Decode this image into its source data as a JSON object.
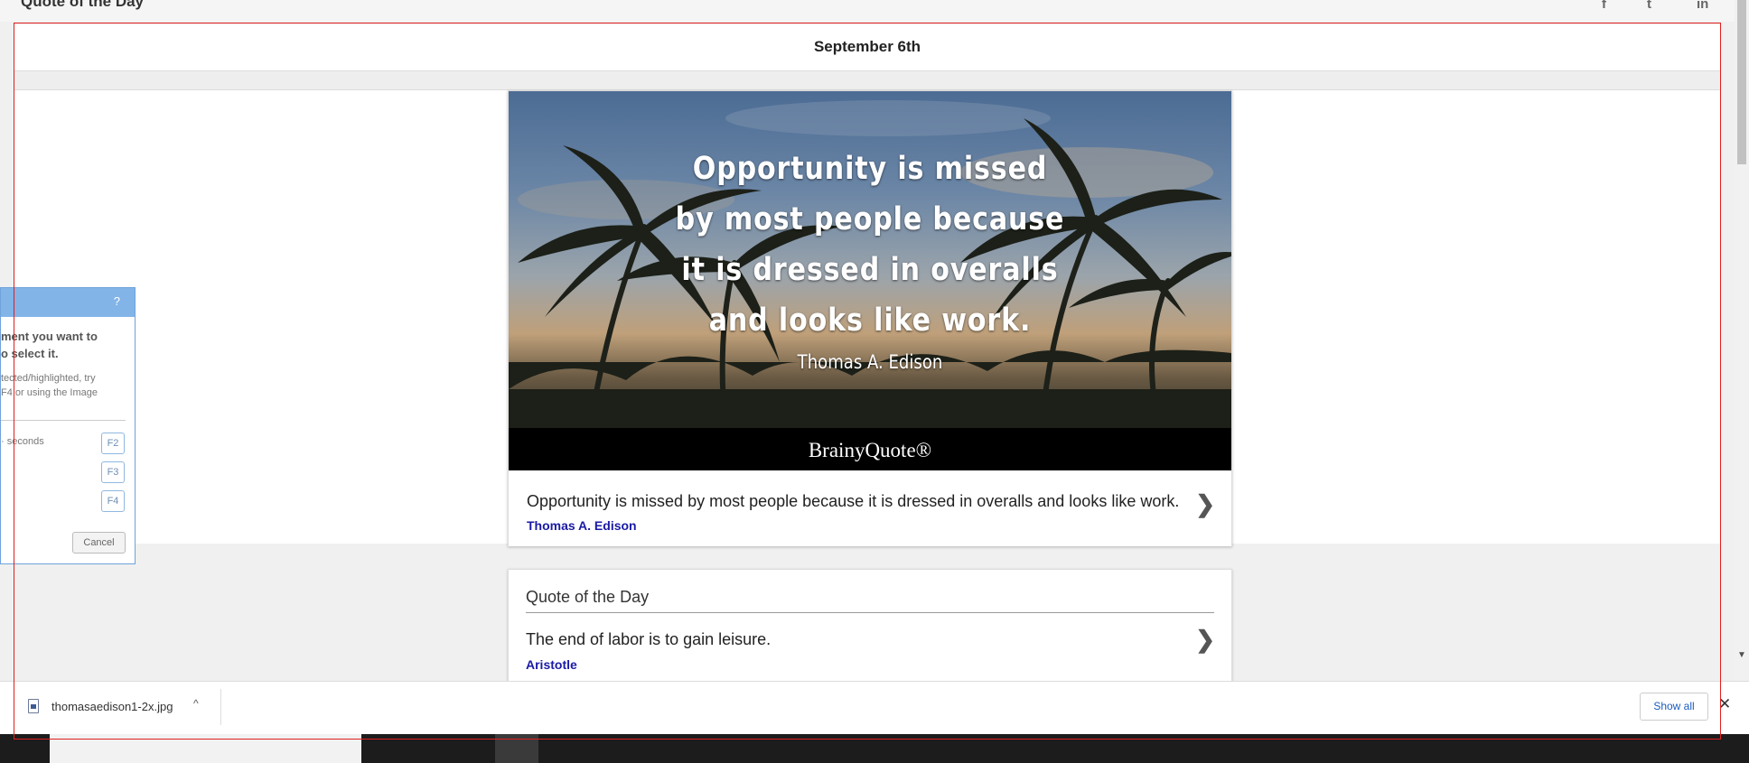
{
  "header": {
    "site_title": "Quote of the Day",
    "social_icons": [
      "facebook-icon",
      "twitter-icon",
      "linkedin-icon"
    ],
    "social_glyphs": {
      "facebook": "f",
      "twitter": "t",
      "linkedin": "in"
    }
  },
  "date_bar": {
    "date": "September 6th"
  },
  "featured": {
    "image_lines": [
      "Opportunity is missed",
      "by most people because",
      "it is dressed in overalls",
      "and looks like work."
    ],
    "image_author": "Thomas A. Edison",
    "brand": "BrainyQuote®",
    "quote": "Opportunity is missed by most people because it is dressed in overalls and looks like work.",
    "author": "Thomas A. Edison",
    "chevron": "❯"
  },
  "qotd_card": {
    "heading": "Quote of the Day",
    "quote": "The end of labor is to gain leisure.",
    "author": "Aristotle",
    "chevron": "❯"
  },
  "snip_panel": {
    "help": "?",
    "instruction": "ment you want to\no select it.",
    "hint": "tected/highlighted, try\nF4 or using the Image",
    "delay_label": "· seconds",
    "keys": [
      "F2",
      "F3",
      "F4"
    ],
    "cancel": "Cancel"
  },
  "download_bar": {
    "file_name": "thomasaedison1-2x.jpg",
    "caret": "^",
    "show_all": "Show all",
    "close": "✕"
  },
  "colors": {
    "accent_red": "#e02020",
    "author_blue": "#1a1aa6",
    "snip_blue": "#82b4e8"
  }
}
